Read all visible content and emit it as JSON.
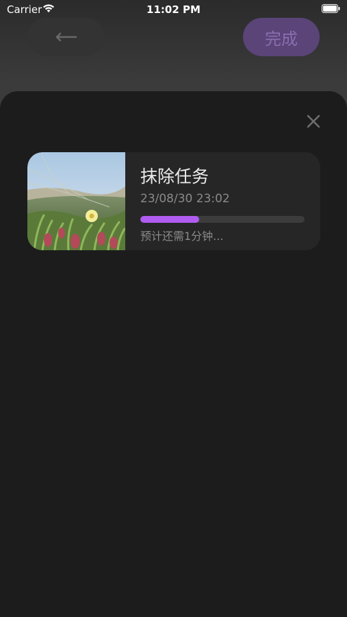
{
  "status_bar": {
    "carrier": "Carrier",
    "time": "11:02 PM",
    "wifi_icon": "wifi-icon",
    "battery_icon": "battery-icon"
  },
  "header": {
    "back_icon": "arrow-left-icon",
    "done_label": "完成"
  },
  "sheet": {
    "close_icon": "close-icon",
    "task": {
      "title": "抹除任务",
      "date": "23/08/30 23:02",
      "progress": 0.36,
      "eta": "预计还需1分钟..."
    }
  },
  "colors": {
    "accent": "#b05cf0",
    "done_button_bg": "#5a4478",
    "sheet_bg": "#1c1c1c",
    "card_bg": "#262626"
  }
}
